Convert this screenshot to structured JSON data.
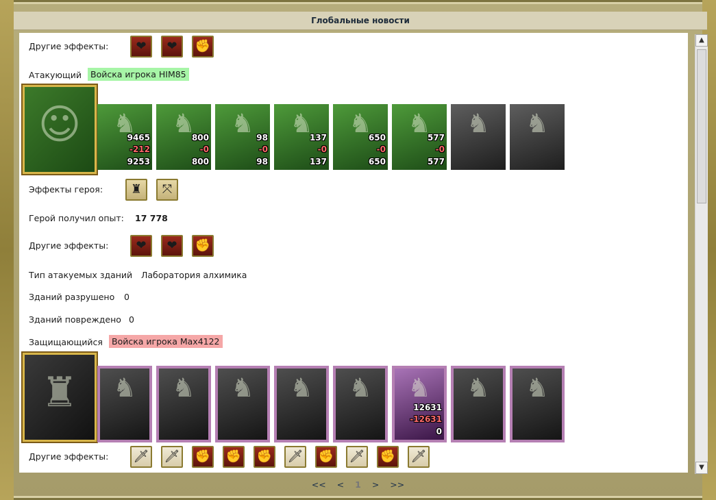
{
  "window": {
    "title": "Глобальные новости"
  },
  "report": {
    "other_effects_top": {
      "label": "Другие эффекты:",
      "icons": [
        "heart-dagger-icon",
        "heart-dagger-icon",
        "fist-sword-icon"
      ]
    },
    "attacker": {
      "label": "Атакующий",
      "owner": "Войска игрока HIM85",
      "units": [
        {
          "before": "9465",
          "lost": "-212",
          "after": "9253"
        },
        {
          "before": "800",
          "lost": "-0",
          "after": "800"
        },
        {
          "before": "98",
          "lost": "-0",
          "after": "98"
        },
        {
          "before": "137",
          "lost": "-0",
          "after": "137"
        },
        {
          "before": "650",
          "lost": "-0",
          "after": "650"
        },
        {
          "before": "577",
          "lost": "-0",
          "after": "577"
        },
        {
          "before": "",
          "lost": "",
          "after": ""
        },
        {
          "before": "",
          "lost": "",
          "after": ""
        }
      ],
      "hero_effects_label": "Эффекты героя:",
      "hero_effects_icons": [
        "tower-icon",
        "crossbow-icon"
      ],
      "exp_label": "Герой получил опыт:",
      "exp_value": "17 778",
      "other_effects_label": "Другие эффекты:",
      "other_effects_icons": [
        "heart-dagger-icon",
        "heart-dagger-icon",
        "fist-sword-icon"
      ]
    },
    "buildings": {
      "type_label": "Тип атакуемых зданий",
      "type_value": "Лаборатория алхимика",
      "destroyed_label": "Зданий разрушено",
      "destroyed_value": "0",
      "damaged_label": "Зданий повреждено",
      "damaged_value": "0"
    },
    "defender": {
      "label": "Защищающийся",
      "owner": "Войска игрока Max4122",
      "units": [
        {
          "before": "",
          "lost": "",
          "after": ""
        },
        {
          "before": "",
          "lost": "",
          "after": ""
        },
        {
          "before": "",
          "lost": "",
          "after": ""
        },
        {
          "before": "",
          "lost": "",
          "after": ""
        },
        {
          "before": "",
          "lost": "",
          "after": ""
        },
        {
          "before": "12631",
          "lost": "-12631",
          "after": "0"
        },
        {
          "before": "",
          "lost": "",
          "after": ""
        },
        {
          "before": "",
          "lost": "",
          "after": ""
        }
      ],
      "other_effects_label": "Другие эффекты:",
      "other_effects_icons": [
        "sword-icon",
        "sword-icon",
        "fist-sword-icon",
        "fist-sword-icon",
        "fist-sword-icon",
        "sword-icon",
        "fist-sword-icon",
        "sword-icon",
        "fist-sword-icon",
        "sword-icon"
      ]
    }
  },
  "pager": {
    "first": "<<",
    "prev": "<",
    "current": "1",
    "next": ">",
    "last": ">>"
  },
  "colors": {
    "attacker_tag": "#a7f5a7",
    "defender_tag": "#f5a7a7",
    "frame": "#b6ad7c"
  }
}
